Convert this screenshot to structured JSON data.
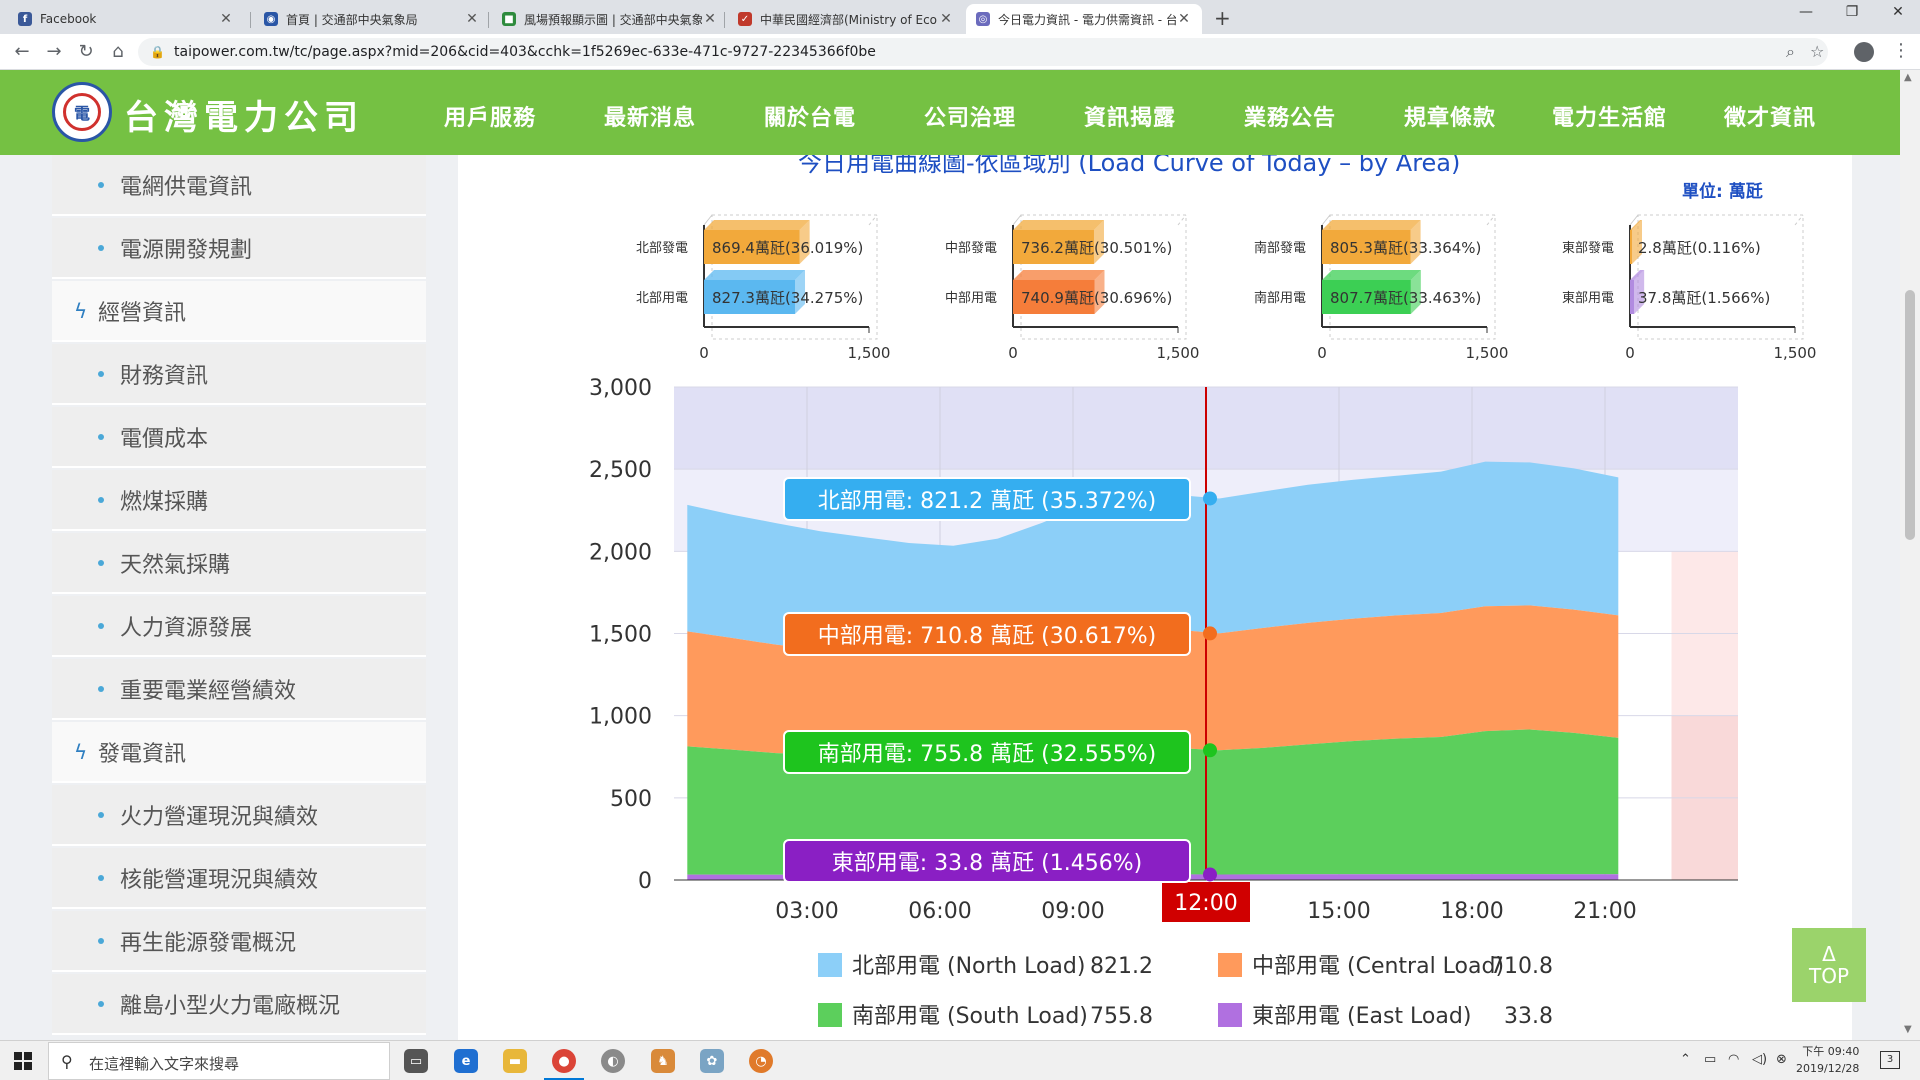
{
  "browser": {
    "tabs": [
      {
        "label": "Facebook",
        "favicon_color": "#3b5998",
        "favicon_glyph": "f"
      },
      {
        "label": "首頁 | 交通部中央氣象局",
        "favicon_color": "#2a56a6",
        "favicon_glyph": "◉"
      },
      {
        "label": "風場預報顯示圖 | 交通部中央氣象",
        "favicon_color": "#2e8b3d",
        "favicon_glyph": "■"
      },
      {
        "label": "中華民國經濟部(Ministry of Econ",
        "favicon_color": "#c0392b",
        "favicon_glyph": "✓"
      },
      {
        "label": "今日電力資訊 - 電力供需資訊 - 台",
        "favicon_color": "#6b6bbd",
        "favicon_glyph": "◎"
      }
    ],
    "url": "taipower.com.tw/tc/page.aspx?mid=206&cid=403&cchk=1f5269ec-633e-471c-9727-22345366f0be"
  },
  "header": {
    "logo_text": "台灣電力公司",
    "nav": [
      "用戶服務",
      "最新消息",
      "關於台電",
      "公司治理",
      "資訊揭露",
      "業務公告",
      "規章條款",
      "電力生活館",
      "徵才資訊"
    ]
  },
  "sidebar": {
    "items": [
      {
        "label": "電網供電資訊",
        "type": "sub"
      },
      {
        "label": "電源開發規劃",
        "type": "sub"
      },
      {
        "label": "經營資訊",
        "type": "head"
      },
      {
        "label": "財務資訊",
        "type": "sub"
      },
      {
        "label": "電價成本",
        "type": "sub"
      },
      {
        "label": "燃煤採購",
        "type": "sub"
      },
      {
        "label": "天然氣採購",
        "type": "sub"
      },
      {
        "label": "人力資源發展",
        "type": "sub"
      },
      {
        "label": "重要電業經營績效",
        "type": "sub"
      },
      {
        "label": "發電資訊",
        "type": "head"
      },
      {
        "label": "火力營運現況與績效",
        "type": "sub"
      },
      {
        "label": "核能營運現況與績效",
        "type": "sub"
      },
      {
        "label": "再生能源發電概況",
        "type": "sub"
      },
      {
        "label": "離島小型火力電廠概況",
        "type": "sub"
      }
    ]
  },
  "content": {
    "title": "今日用電曲線圖-依區域別 (Load Curve of Today – by Area)",
    "unit": "單位: 萬瓩"
  },
  "chart_data": [
    {
      "type": "bar",
      "region": "北",
      "categories": [
        "北部發電",
        "北部用電"
      ],
      "values": [
        869.4,
        827.3
      ],
      "data_labels": [
        "869.4萬瓩(36.019%)",
        "827.3萬瓩(34.275%)"
      ],
      "colors": [
        "#f2a93b",
        "#5bb8f0"
      ],
      "xlim": [
        0,
        1500
      ],
      "xticks": [
        "0",
        "1,500"
      ]
    },
    {
      "type": "bar",
      "region": "中",
      "categories": [
        "中部發電",
        "中部用電"
      ],
      "values": [
        736.2,
        740.9
      ],
      "data_labels": [
        "736.2萬瓩(30.501%)",
        "740.9萬瓩(30.696%)"
      ],
      "colors": [
        "#f2a93b",
        "#f57d3a"
      ],
      "xlim": [
        0,
        1500
      ],
      "xticks": [
        "0",
        "1,500"
      ]
    },
    {
      "type": "bar",
      "region": "南",
      "categories": [
        "南部發電",
        "南部用電"
      ],
      "values": [
        805.3,
        807.7
      ],
      "data_labels": [
        "805.3萬瓩(33.364%)",
        "807.7萬瓩(33.463%)"
      ],
      "colors": [
        "#f2a93b",
        "#3ccf54"
      ],
      "xlim": [
        0,
        1500
      ],
      "xticks": [
        "0",
        "1,500"
      ]
    },
    {
      "type": "bar",
      "region": "東",
      "categories": [
        "東部發電",
        "東部用電"
      ],
      "values": [
        2.8,
        37.8
      ],
      "data_labels": [
        "2.8萬瓩(0.116%)",
        "37.8萬瓩(1.566%)"
      ],
      "colors": [
        "#f2a93b",
        "#b18be0"
      ],
      "xlim": [
        0,
        1500
      ],
      "xticks": [
        "0",
        "1,500"
      ]
    },
    {
      "type": "area",
      "stacked": true,
      "x_hours": [
        0,
        1,
        2,
        3,
        4,
        5,
        6,
        7,
        8,
        9,
        10,
        11,
        12,
        13,
        14,
        15,
        16,
        17,
        18,
        19,
        20,
        21,
        22,
        23,
        24
      ],
      "xlim": [
        0,
        24
      ],
      "ylim": [
        0,
        3000
      ],
      "yticks": [
        "0",
        "500",
        "1,000",
        "1,500",
        "2,000",
        "2,500",
        "3,000"
      ],
      "xticks": [
        "03:00",
        "06:00",
        "09:00",
        "12:00",
        "15:00",
        "18:00",
        "21:00"
      ],
      "xtick_hours": [
        3,
        6,
        9,
        12,
        15,
        18,
        21
      ],
      "highlight_tick": "12:00",
      "cursor_hour": 12,
      "series": [
        {
          "name": "東部用電 (East Load)",
          "color": "#b070e0",
          "values": [
            33,
            33,
            32,
            32,
            31,
            31,
            31,
            32,
            33,
            34,
            34,
            34,
            33.8,
            34,
            35,
            35,
            35,
            35,
            36,
            36,
            35,
            35
          ]
        },
        {
          "name": "南部用電 (South Load)",
          "color": "#5ccf5c",
          "values": [
            780,
            760,
            740,
            730,
            725,
            720,
            718,
            730,
            760,
            790,
            790,
            770,
            755.8,
            770,
            790,
            810,
            825,
            835,
            870,
            880,
            860,
            830
          ]
        },
        {
          "name": "中部用電 (Central Load)",
          "color": "#ff9a5c",
          "values": [
            700,
            680,
            660,
            640,
            630,
            620,
            615,
            625,
            660,
            700,
            720,
            720,
            710.8,
            730,
            740,
            745,
            750,
            755,
            760,
            755,
            750,
            745
          ]
        },
        {
          "name": "北部用電 (North Load)",
          "color": "#8ccff8",
          "values": [
            770,
            750,
            740,
            720,
            700,
            680,
            670,
            690,
            720,
            760,
            800,
            820,
            821.2,
            830,
            840,
            845,
            850,
            860,
            880,
            870,
            860,
            840
          ]
        }
      ],
      "tooltips": [
        {
          "text": "北部用電: 821.2 萬瓩 (35.372%)",
          "color": "#35aef0"
        },
        {
          "text": "中部用電: 710.8 萬瓩 (30.617%)",
          "color": "#f26d1e"
        },
        {
          "text": "南部用電: 755.8 萬瓩 (32.555%)",
          "color": "#1ec41e"
        },
        {
          "text": "東部用電: 33.8 萬瓩 (1.456%)",
          "color": "#8a1fc4"
        }
      ],
      "legend": [
        {
          "label": "北部用電 (North Load)",
          "value": "821.2",
          "color": "#8ccff8"
        },
        {
          "label": "中部用電 (Central Load)",
          "value": "710.8",
          "color": "#ff9a5c"
        },
        {
          "label": "南部用電 (South Load)",
          "value": "755.8",
          "color": "#5ccf5c"
        },
        {
          "label": "東部用電 (East Load)",
          "value": "33.8",
          "color": "#b070e0"
        }
      ]
    }
  ],
  "top_button": {
    "arrow": "Δ",
    "label": "TOP"
  },
  "taskbar": {
    "search_placeholder": "在這裡輸入文字來搜尋",
    "time": "下午 09:40",
    "date": "2019/12/28",
    "notification_count": "3"
  }
}
